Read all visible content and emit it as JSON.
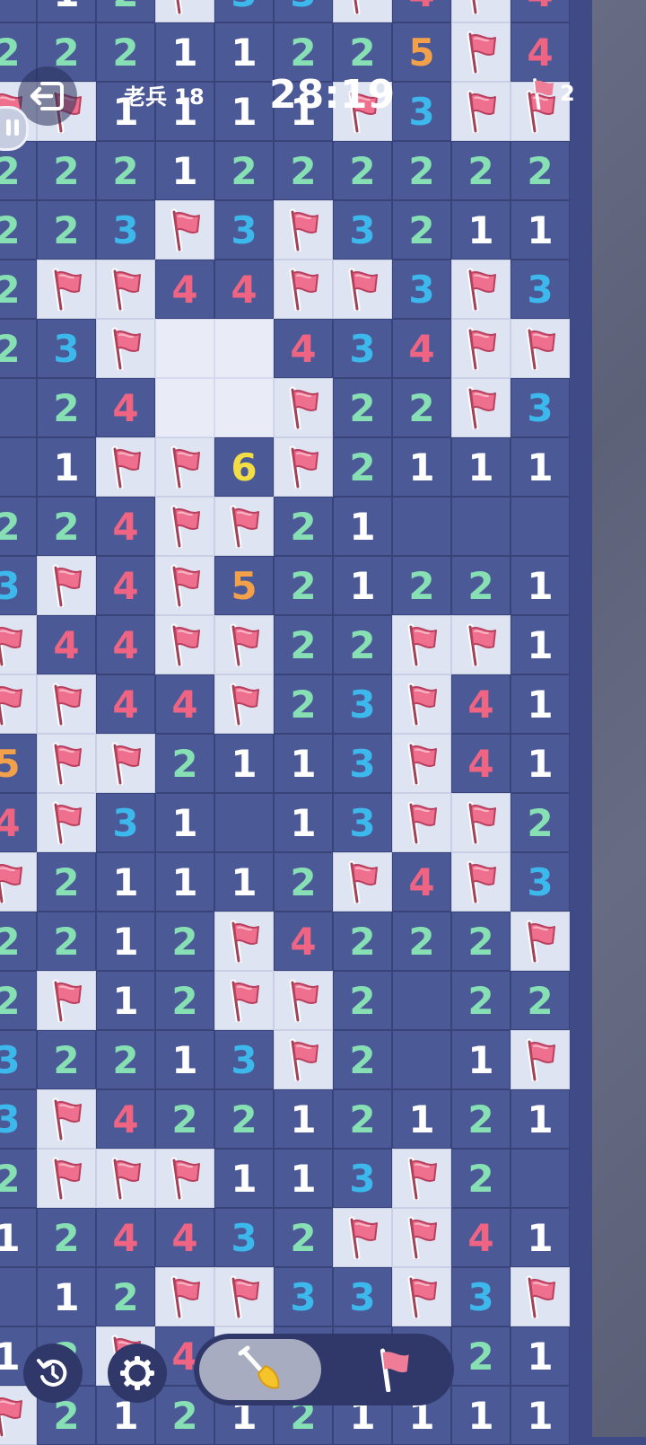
{
  "header": {
    "difficulty": "老兵 18",
    "timer": "28:19",
    "flags_remaining": "2"
  },
  "icons": {
    "exit": "exit-icon",
    "pause": "pause-icon",
    "restart": "restart-icon",
    "settings": "gear-icon",
    "dig": "shovel-icon",
    "flag": "flag-icon"
  },
  "colors": {
    "board": "#3f4b86",
    "revealed": "#4b5a96",
    "hidden": "#dfe4f2",
    "flag": "#ef6f8e",
    "n1": "#ffffff",
    "n2": "#86e0b4",
    "n3": "#3cb8ec",
    "n4": "#ef6483",
    "n5": "#f3a04a",
    "n6": "#f3dd45"
  },
  "board_rows": [
    [
      " ",
      "1",
      "2",
      "F",
      "3",
      "3",
      "F",
      "4",
      "F",
      "4"
    ],
    [
      "2",
      "2",
      "2",
      "1",
      "1",
      "2",
      "2",
      "5",
      "F",
      "4"
    ],
    [
      "F",
      "F",
      "1",
      "1",
      "1",
      "1",
      "F",
      "3",
      "F",
      "F"
    ],
    [
      "2",
      "2",
      "2",
      "1",
      "2",
      "2",
      "2",
      "2",
      "2",
      "2"
    ],
    [
      "2",
      "2",
      "3",
      "F",
      "3",
      "F",
      "3",
      "2",
      "1",
      "1"
    ],
    [
      "2",
      "F",
      "F",
      "4",
      "4",
      "F",
      "F",
      "3",
      "F",
      "3"
    ],
    [
      "2",
      "3",
      "F",
      "_",
      "_",
      "4",
      "3",
      "4",
      "F",
      "F"
    ],
    [
      " ",
      "2",
      "4",
      "_",
      "_",
      "F",
      "2",
      "2",
      "F",
      "3"
    ],
    [
      " ",
      "1",
      "F",
      "F",
      "6",
      "F",
      "2",
      "1",
      "1",
      "1"
    ],
    [
      "2",
      "2",
      "4",
      "F",
      "F",
      "2",
      "1",
      " ",
      " ",
      " "
    ],
    [
      "3",
      "F",
      "4",
      "F",
      "5",
      "2",
      "1",
      "2",
      "2",
      "1"
    ],
    [
      "F",
      "4",
      "4",
      "F",
      "F",
      "2",
      "2",
      "F",
      "F",
      "1"
    ],
    [
      "F",
      "F",
      "4",
      "4",
      "F",
      "2",
      "3",
      "F",
      "4",
      "1"
    ],
    [
      "5",
      "F",
      "F",
      "2",
      "1",
      "1",
      "3",
      "F",
      "4",
      "1"
    ],
    [
      "4",
      "F",
      "3",
      "1",
      " ",
      "1",
      "3",
      "F",
      "F",
      "2"
    ],
    [
      "F",
      "2",
      "1",
      "1",
      "1",
      "2",
      "F",
      "4",
      "F",
      "3"
    ],
    [
      "2",
      "2",
      "1",
      "2",
      "F",
      "4",
      "2",
      "2",
      "2",
      "F"
    ],
    [
      "2",
      "F",
      "1",
      "2",
      "F",
      "F",
      "2",
      " ",
      "2",
      "2"
    ],
    [
      "3",
      "2",
      "2",
      "1",
      "3",
      "F",
      "2",
      " ",
      "1",
      "F"
    ],
    [
      "3",
      "F",
      "4",
      "2",
      "2",
      "1",
      "2",
      "1",
      "2",
      "1"
    ],
    [
      "2",
      "F",
      "F",
      "F",
      "1",
      "1",
      "3",
      "F",
      "2",
      " "
    ],
    [
      "1",
      "2",
      "4",
      "4",
      "3",
      "2",
      "F",
      "F",
      "4",
      "1"
    ],
    [
      " ",
      "1",
      "2",
      "F",
      "F",
      "3",
      "3",
      "F",
      "3",
      "F"
    ],
    [
      "1",
      "2",
      "F",
      "4",
      "F",
      "2",
      "2",
      "2",
      "2",
      "1"
    ],
    [
      "F",
      "2",
      "1",
      "2",
      "1",
      "2",
      "1",
      "1",
      "1",
      "1"
    ]
  ]
}
